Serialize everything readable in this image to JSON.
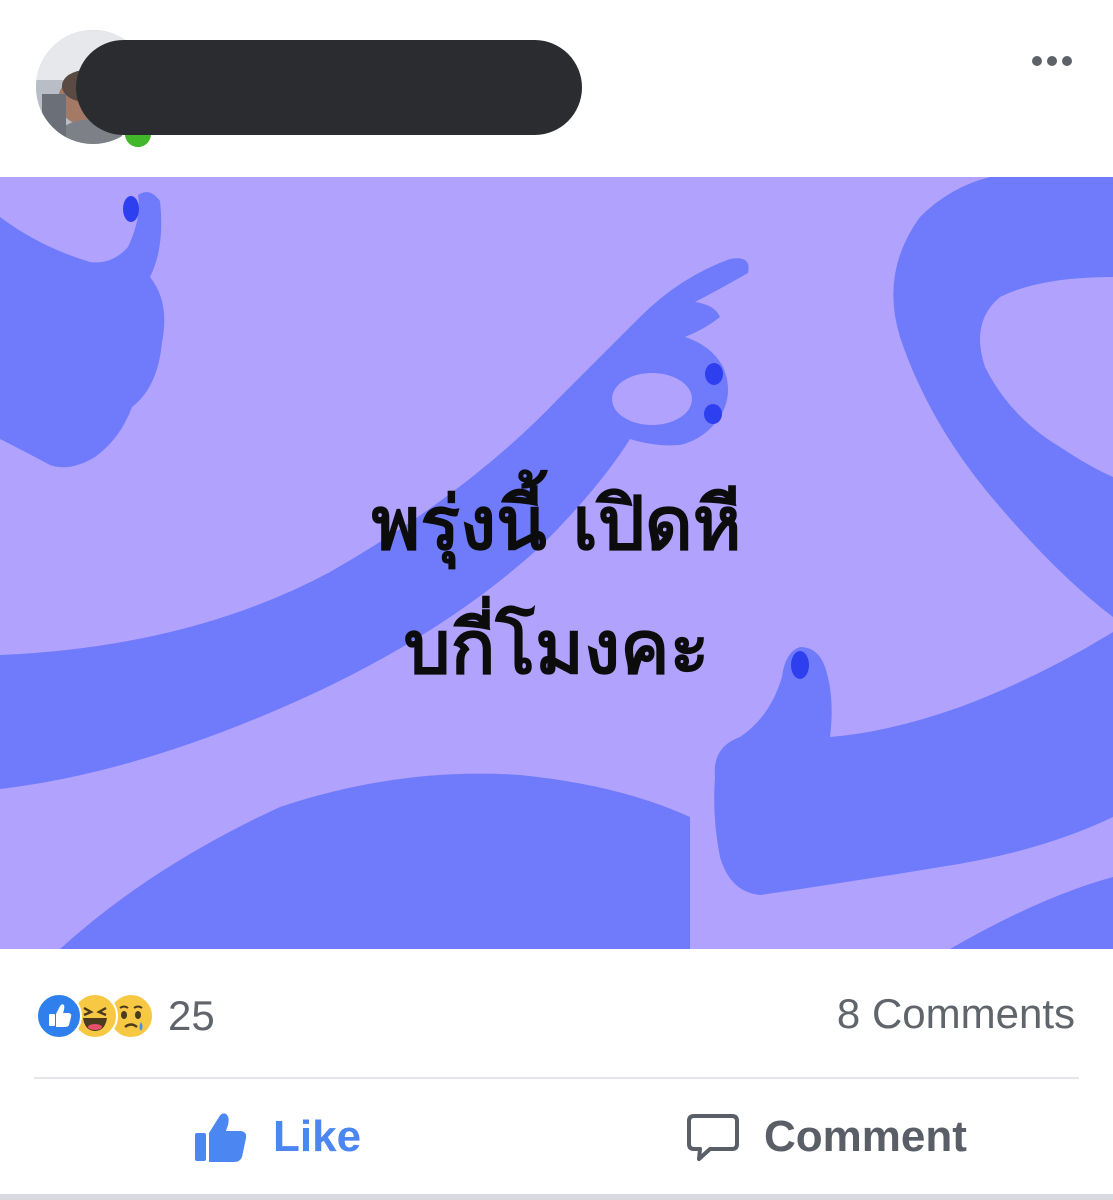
{
  "post": {
    "author_name": "",
    "status_lines": [
      "พรุ่งนี้ เปิดหี",
      "บกี่โมงคะ"
    ],
    "background_colors": {
      "field": "#b1a2fd",
      "hands": "#6f7bfb",
      "nails": "#2e3ff0"
    }
  },
  "reactions": {
    "types": [
      "like",
      "haha",
      "sad"
    ],
    "count": "25"
  },
  "comments": {
    "count_label": "8 Comments"
  },
  "actions": {
    "like_label": "Like",
    "comment_label": "Comment"
  },
  "icons": {
    "more": "more-horizontal-icon",
    "like": "thumbs-up-icon",
    "comment": "speech-bubble-icon"
  }
}
